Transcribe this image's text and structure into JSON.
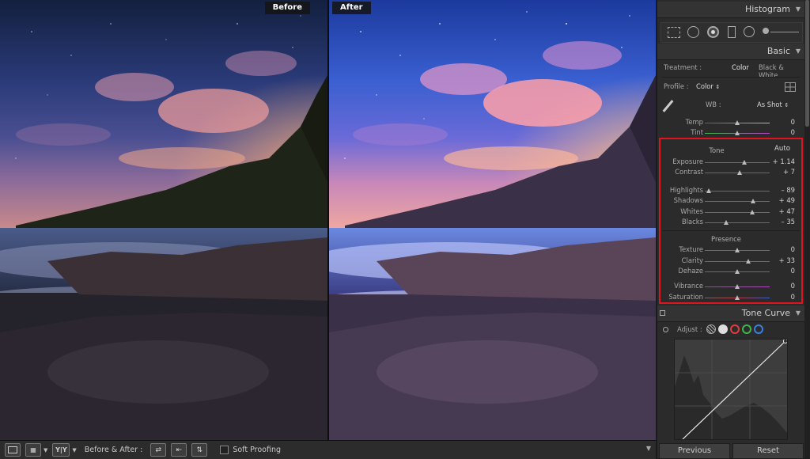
{
  "before_after": {
    "before": "Before",
    "after": "After"
  },
  "toolbar": {
    "before_after_label": "Before & After :",
    "soft_proofing": "Soft Proofing",
    "yy_label": "Y|Y"
  },
  "panel": {
    "histogram_title": "Histogram",
    "basic_title": "Basic",
    "treatment_label": "Treatment :",
    "treatment_color": "Color",
    "treatment_bw": "Black & White",
    "profile_label": "Profile :",
    "profile_value": "Color",
    "wb_label": "WB :",
    "wb_value": "As Shot",
    "temp": {
      "label": "Temp",
      "value": "0",
      "pos": 0.5
    },
    "tint": {
      "label": "Tint",
      "value": "0",
      "pos": 0.5
    },
    "tone_title": "Tone",
    "auto_label": "Auto",
    "exposure": {
      "label": "Exposure",
      "value": "+ 1.14",
      "pos": 0.61
    },
    "contrast": {
      "label": "Contrast",
      "value": "+ 7",
      "pos": 0.535
    },
    "highlights": {
      "label": "Highlights",
      "value": "– 89",
      "pos": 0.055
    },
    "shadows": {
      "label": "Shadows",
      "value": "+ 49",
      "pos": 0.745
    },
    "whites": {
      "label": "Whites",
      "value": "+ 47",
      "pos": 0.735
    },
    "blacks": {
      "label": "Blacks",
      "value": "– 35",
      "pos": 0.325
    },
    "presence_title": "Presence",
    "texture": {
      "label": "Texture",
      "value": "0",
      "pos": 0.5
    },
    "clarity": {
      "label": "Clarity",
      "value": "+ 33",
      "pos": 0.665
    },
    "dehaze": {
      "label": "Dehaze",
      "value": "0",
      "pos": 0.5
    },
    "vibrance": {
      "label": "Vibrance",
      "value": "0",
      "pos": 0.5
    },
    "saturation": {
      "label": "Saturation",
      "value": "0",
      "pos": 0.5
    },
    "tone_curve_title": "Tone Curve",
    "adjust_label": "Adjust :",
    "previous_button": "Previous",
    "reset_button": "Reset"
  },
  "colors": {
    "highlight_box": "#e0141e",
    "curve_red": "#e23c3c",
    "curve_green": "#3cb84a",
    "curve_blue": "#3c7fe2"
  }
}
